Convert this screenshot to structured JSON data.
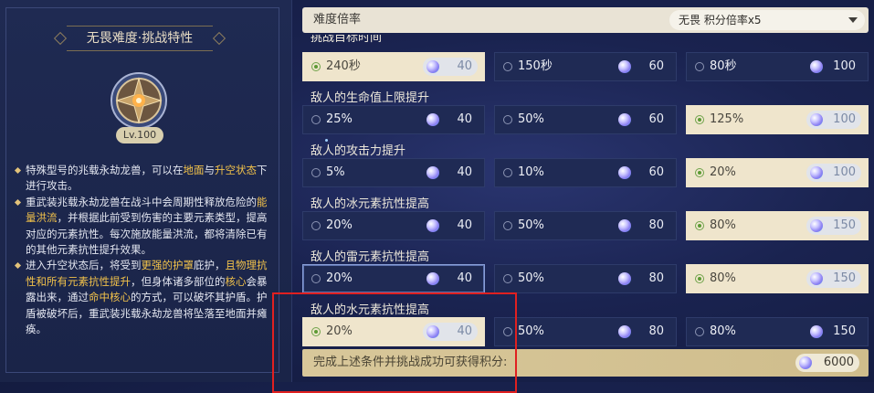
{
  "left": {
    "title": "无畏难度·挑战特性",
    "level": "Lv.100",
    "desc": [
      [
        {
          "t": "特殊型号的兆载永劫龙兽，可以在",
          "h": false
        },
        {
          "t": "地面",
          "h": true
        },
        {
          "t": "与",
          "h": false
        },
        {
          "t": "升空状态",
          "h": true
        },
        {
          "t": "下进行攻击。",
          "h": false
        }
      ],
      [
        {
          "t": "重武装兆载永劫龙兽在战斗中会周期性释放危险的",
          "h": false
        },
        {
          "t": "能量洪流",
          "h": true
        },
        {
          "t": "，并根据此前受到伤害的主要元素类型，提高对应的元素抗性。每次施放能量洪流，都将清除已有的其他元素抗性提升效果。",
          "h": false
        }
      ],
      [
        {
          "t": "进入升空状态后，将受到",
          "h": false
        },
        {
          "t": "更强的护罩",
          "h": true
        },
        {
          "t": "庇护，",
          "h": false
        },
        {
          "t": "且物理抗性和所有元素抗性提升",
          "h": true
        },
        {
          "t": "，但身体诸多部位的",
          "h": false
        },
        {
          "t": "核心",
          "h": true
        },
        {
          "t": "会暴露出来，通过",
          "h": false
        },
        {
          "t": "命中核心",
          "h": true
        },
        {
          "t": "的方式，可以破坏其护盾。护盾被破坏后，重武装兆载永劫龙兽将坠落至地面并瘫痪。",
          "h": false
        }
      ]
    ]
  },
  "topbar": {
    "label": "难度倍率",
    "dropdown_value": "无畏  积分倍率x5"
  },
  "sections": [
    {
      "label": "挑战目标时间",
      "cut": true,
      "options": [
        {
          "label": "240秒",
          "score": "40",
          "selected": true
        },
        {
          "label": "150秒",
          "score": "60",
          "selected": false
        },
        {
          "label": "80秒",
          "score": "100",
          "selected": false
        }
      ]
    },
    {
      "label": "敌人的生命值上限提升",
      "cut": false,
      "options": [
        {
          "label": "25%",
          "score": "40",
          "selected": false
        },
        {
          "label": "50%",
          "score": "60",
          "selected": false
        },
        {
          "label": "125%",
          "score": "100",
          "selected": true
        }
      ]
    },
    {
      "label": "敌人的攻击力提升",
      "cut": false,
      "options": [
        {
          "label": "5%",
          "score": "40",
          "selected": false
        },
        {
          "label": "10%",
          "score": "60",
          "selected": false
        },
        {
          "label": "20%",
          "score": "100",
          "selected": true
        }
      ]
    },
    {
      "label": "敌人的冰元素抗性提高",
      "cut": false,
      "options": [
        {
          "label": "20%",
          "score": "40",
          "selected": false
        },
        {
          "label": "50%",
          "score": "80",
          "selected": false
        },
        {
          "label": "80%",
          "score": "150",
          "selected": true
        }
      ]
    },
    {
      "label": "敌人的雷元素抗性提高",
      "cut": false,
      "options": [
        {
          "label": "20%",
          "score": "40",
          "selected": false
        },
        {
          "label": "50%",
          "score": "80",
          "selected": false
        },
        {
          "label": "80%",
          "score": "150",
          "selected": true
        }
      ]
    },
    {
      "label": "敌人的水元素抗性提高",
      "cut": false,
      "options": [
        {
          "label": "20%",
          "score": "40",
          "selected": true
        },
        {
          "label": "50%",
          "score": "80",
          "selected": false
        },
        {
          "label": "80%",
          "score": "150",
          "selected": false
        }
      ]
    }
  ],
  "bottom": {
    "label": "完成上述条件并挑战成功可获得积分:",
    "total": "6000"
  }
}
